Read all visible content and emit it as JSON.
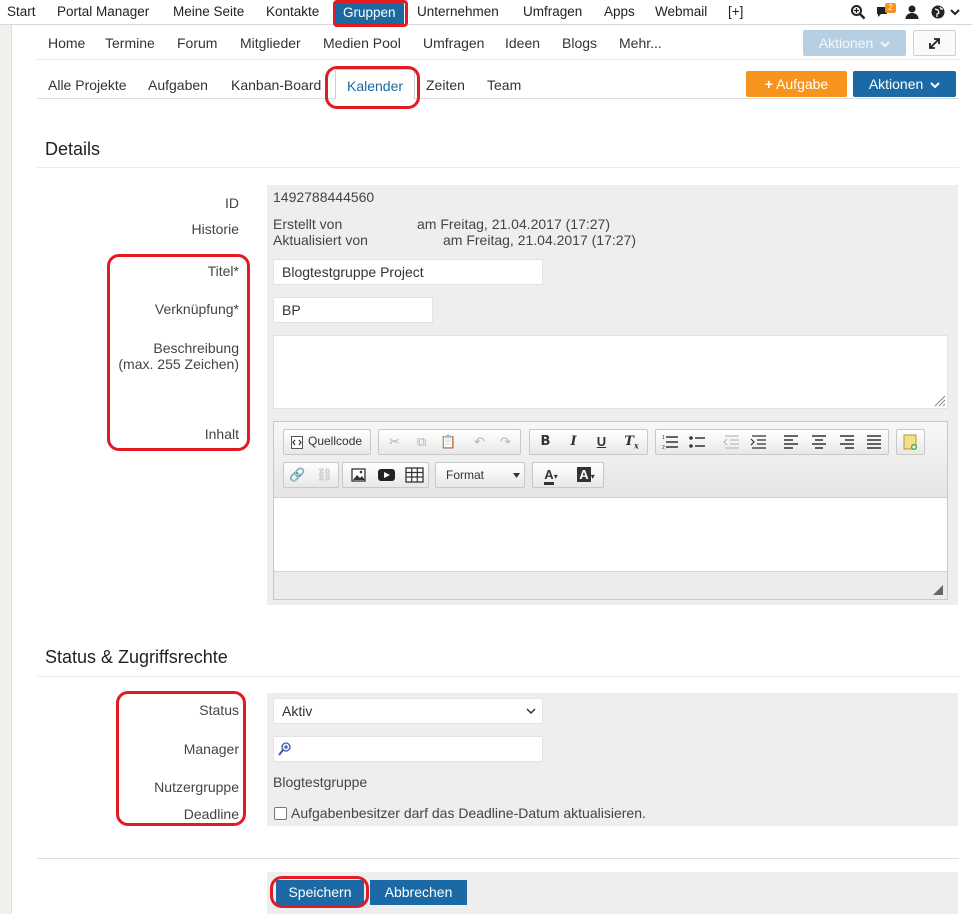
{
  "topnav": {
    "items": [
      "Start",
      "Portal Manager",
      "Meine Seite",
      "Kontakte",
      "Gruppen",
      "Unternehmen",
      "Umfragen",
      "Apps",
      "Webmail",
      "[+]"
    ],
    "active": "Gruppen",
    "notification_count": "2",
    "icons": [
      "search-zoom-icon",
      "chat-icon",
      "user-icon",
      "globe-icon",
      "chevron-down-icon"
    ]
  },
  "subnav": {
    "items": [
      "Home",
      "Termine",
      "Forum",
      "Mitglieder",
      "Medien Pool",
      "Umfragen",
      "Ideen",
      "Blogs",
      "Mehr..."
    ],
    "actions_label": "Aktionen"
  },
  "tabs": {
    "items": [
      "Alle Projekte",
      "Aufgaben",
      "Kanban-Board",
      "Kalender",
      "Zeiten",
      "Team"
    ],
    "active": "Kalender",
    "add_task_label": "Aufgabe",
    "actions_label": "Aktionen"
  },
  "details": {
    "title": "Details",
    "id_label": "ID",
    "id_value": "1492788444560",
    "history_label": "Historie",
    "created_by": "Erstellt von",
    "created_at": "am Freitag, 21.04.2017 (17:27)",
    "updated_by": "Aktualisiert von",
    "updated_at": "am Freitag, 21.04.2017 (17:27)",
    "title_label": "Titel*",
    "title_value": "Blogtestgruppe Project",
    "link_label": "Verknüpfung*",
    "link_value": "BP",
    "description_label": "Beschreibung",
    "description_hint": "(max. 255 Zeichen)",
    "description_value": "",
    "content_label": "Inhalt"
  },
  "editor": {
    "source_label": "Quellcode",
    "format_label": "Format"
  },
  "status": {
    "title": "Status & Zugriffsrechte",
    "status_label": "Status",
    "status_value": "Aktiv",
    "manager_label": "Manager",
    "manager_value": "",
    "usergroup_label": "Nutzergruppe",
    "usergroup_value": "Blogtestgruppe",
    "deadline_label": "Deadline",
    "deadline_checkbox_label": "Aufgabenbesitzer darf das Deadline-Datum aktualisieren.",
    "deadline_checked": false
  },
  "footer": {
    "save_label": "Speichern",
    "cancel_label": "Abbrechen"
  },
  "colors": {
    "primary": "#1b6aa5",
    "accent_orange": "#f7941d",
    "annotation_red": "#e01b22",
    "notification_badge": "#f7941d"
  }
}
